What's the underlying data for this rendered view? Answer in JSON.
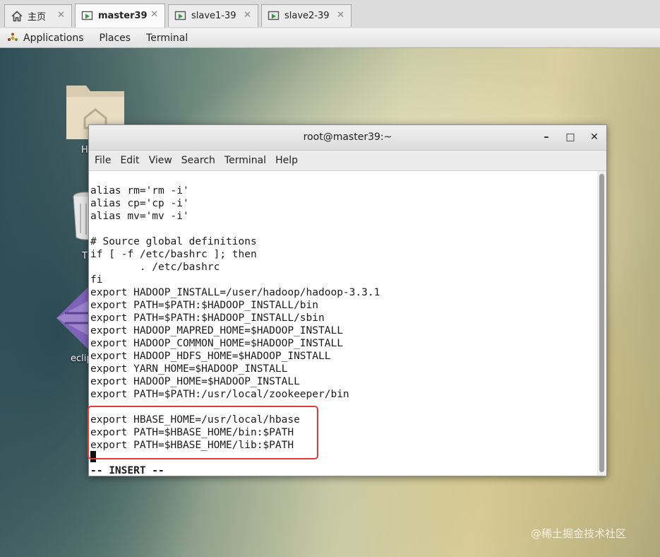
{
  "vm_tabs": [
    {
      "label": "主页",
      "icon": "home-icon"
    },
    {
      "label": "master39",
      "icon": "vm-running-icon",
      "active": true
    },
    {
      "label": "slave1-39",
      "icon": "vm-running-icon"
    },
    {
      "label": "slave2-39",
      "icon": "vm-running-icon"
    }
  ],
  "tab_close_glyph": "✕",
  "topbar": {
    "applications": "Applications",
    "places": "Places",
    "terminal": "Terminal"
  },
  "desktop_icons": [
    {
      "label": "H",
      "icon": "home-folder-icon"
    },
    {
      "label": "T",
      "icon": "trash-icon"
    },
    {
      "label": "eclip",
      "icon": "eclipse-icon"
    }
  ],
  "window": {
    "title": "root@master39:~",
    "minimize": "–",
    "maximize": "□",
    "close": "✕",
    "menu": [
      "File",
      "Edit",
      "View",
      "Search",
      "Terminal",
      "Help"
    ]
  },
  "terminal_lines": [
    "alias rm='rm -i'",
    "alias cp='cp -i'",
    "alias mv='mv -i'",
    "",
    "# Source global definitions",
    "if [ -f /etc/bashrc ]; then",
    "        . /etc/bashrc",
    "fi",
    "export HADOOP_INSTALL=/user/hadoop/hadoop-3.3.1",
    "export PATH=$PATH:$HADOOP_INSTALL/bin",
    "export PATH=$PATH:$HADOOP_INSTALL/sbin",
    "export HADOOP_MAPRED_HOME=$HADOOP_INSTALL",
    "export HADOOP_COMMON_HOME=$HADOOP_INSTALL",
    "export HADOOP_HDFS_HOME=$HADOOP_INSTALL",
    "export YARN_HOME=$HADOOP_INSTALL",
    "export HADOOP_HOME=$HADOOP_INSTALL",
    "export PATH=$PATH:/usr/local/zookeeper/bin",
    "",
    "export HBASE_HOME=/usr/local/hbase",
    "export PATH=$HBASE_HOME/bin:$PATH",
    "export PATH=$HBASE_HOME/lib:$PATH",
    "",
    "-- INSERT --"
  ],
  "highlight_color": "#e53935",
  "watermark": "@稀土掘金技术社区"
}
